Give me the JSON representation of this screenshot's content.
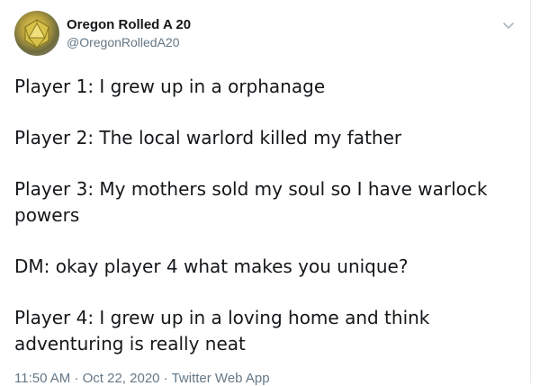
{
  "user": {
    "display_name": "Oregon Rolled A 20",
    "handle": "@OregonRolledA20"
  },
  "tweet": {
    "paragraphs": [
      "Player 1: I grew up in a orphanage",
      "Player 2: The local warlord killed my father",
      "Player 3: My mothers sold my soul so I have warlock powers",
      "DM: okay player 4 what makes you unique?",
      "Player 4: I grew up in a loving home and think adventuring is really neat"
    ]
  },
  "footer": {
    "time": "11:50 AM",
    "separator": "·",
    "date": "Oct 22, 2020",
    "source": "Twitter Web App"
  },
  "icons": {
    "avatar": "d20-avatar-icon",
    "menu": "chevron-down-icon"
  },
  "colors": {
    "text_primary": "#14171a",
    "text_secondary": "#657786",
    "chevron": "#aab8c2"
  }
}
